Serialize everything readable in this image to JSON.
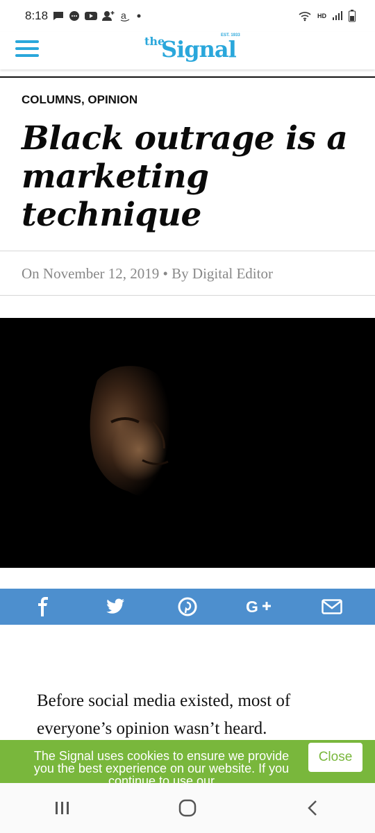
{
  "status_bar": {
    "time": "8:18",
    "network": "HD",
    "icons": [
      "message-icon",
      "chat-bubble-icon",
      "youtube-icon",
      "add-contact-icon",
      "amazon-icon",
      "dot-icon",
      "wifi-icon",
      "signal-icon",
      "battery-icon"
    ]
  },
  "header": {
    "logo_the": "the",
    "logo_name": "Signal",
    "logo_est": "EST. 1933",
    "brand_color": "#2aa7db"
  },
  "article": {
    "category": "COLUMNS, OPINION",
    "title": "Black outrage is a marketing technique",
    "meta": "On November 12, 2019 • By Digital Editor",
    "hero_alt": "Portrait of a man's face lit from the side against a black background",
    "body_first": "Before social media existed, most of everyone’s opinion wasn’t heard."
  },
  "share": {
    "bar_color": "#4d8fce",
    "buttons": [
      "facebook-icon",
      "twitter-icon",
      "pinterest-icon",
      "google-plus-icon",
      "email-icon"
    ]
  },
  "cookie": {
    "text": "The Signal uses cookies to ensure we provide you the best experience on our website. If you continue to use our",
    "close_label": "Close",
    "color": "#79b73c"
  },
  "nav": {
    "buttons": [
      "recent-apps-icon",
      "home-icon",
      "back-icon"
    ]
  }
}
